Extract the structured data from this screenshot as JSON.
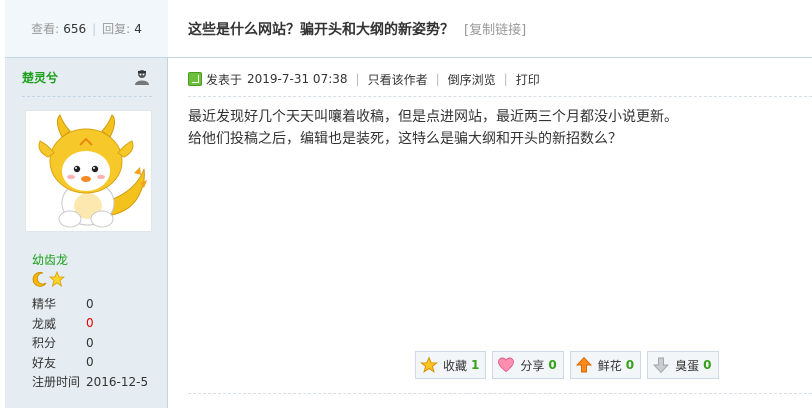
{
  "stats": {
    "views_label": "查看:",
    "views": "656",
    "replies_label": "回复:",
    "replies": "4"
  },
  "thread": {
    "title": "这些是什么网站？骗开头和大纲的新姿势？",
    "copy_link": "[复制链接]"
  },
  "author": {
    "name": "楚灵兮",
    "rank": "幼齿龙",
    "stats": [
      {
        "label": "精华",
        "value": "0"
      },
      {
        "label": "龙威",
        "value": "0"
      },
      {
        "label": "积分",
        "value": "0"
      },
      {
        "label": "好友",
        "value": "0"
      },
      {
        "label": "注册时间",
        "value": "2016-12-5"
      }
    ]
  },
  "post": {
    "posted_prefix": "发表于",
    "posted_time": "2019-7-31 07:38",
    "only_author": "只看该作者",
    "reverse": "倒序浏览",
    "print": "打印",
    "lines": [
      "最近发现好几个天天叫嚷着收稿，但是点进网站，最近两三个月都没小说更新。",
      "给他们投稿之后，编辑也是装死，这特么是骗大纲和开头的新招数么？"
    ]
  },
  "actions": [
    {
      "label": "收藏",
      "count": "1",
      "icon": "star-icon"
    },
    {
      "label": "分享",
      "count": "0",
      "icon": "heart-icon"
    },
    {
      "label": "鲜花",
      "count": "0",
      "icon": "arrow-up-icon"
    },
    {
      "label": "臭蛋",
      "count": "0",
      "icon": "arrow-down-icon"
    }
  ]
}
